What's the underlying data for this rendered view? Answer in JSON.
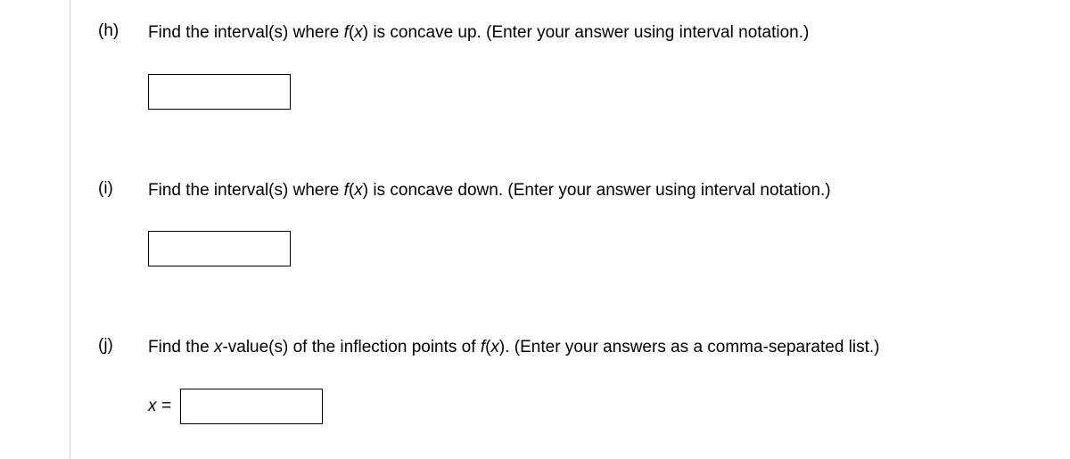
{
  "questions": {
    "h": {
      "label": "(h)",
      "text_pre": "Find the interval(s) where ",
      "func": "f",
      "var": "x",
      "text_post": " is concave up. (Enter your answer using interval notation.)",
      "value": ""
    },
    "i": {
      "label": "(i)",
      "text_pre": "Find the interval(s) where ",
      "func": "f",
      "var": "x",
      "text_post": " is concave down. (Enter your answer using interval notation.)",
      "value": ""
    },
    "j": {
      "label": "(j)",
      "text_pre": "Find the ",
      "xval": "x",
      "text_mid": "-value(s) of the inflection points of ",
      "func": "f",
      "var": "x",
      "text_post": ". (Enter your answers as a comma-separated list.)",
      "prefix_var": "x",
      "prefix_eq": " =",
      "value": ""
    }
  }
}
